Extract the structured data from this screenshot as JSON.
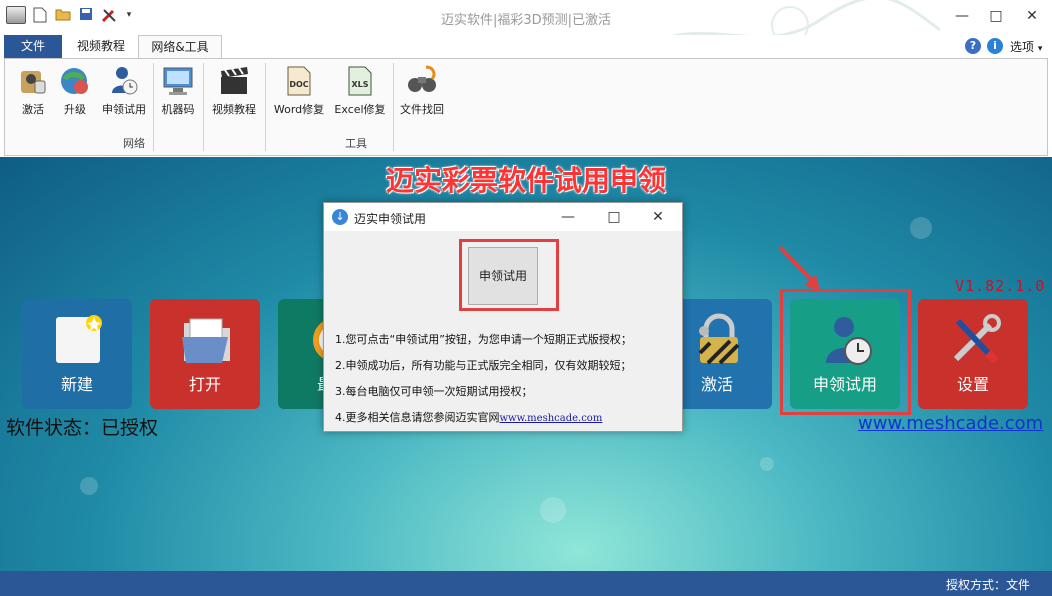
{
  "window": {
    "title": "迈实软件|福彩3D预测|已激活",
    "minimize": "—",
    "maximize": "□",
    "close": "✕"
  },
  "quick_access": [
    "new-doc-icon",
    "open-folder-icon",
    "save-icon",
    "tools-icon",
    "dropdown-icon"
  ],
  "ribbon_tabs": [
    {
      "label": "文件"
    },
    {
      "label": "视频教程"
    },
    {
      "label": "网络&工具",
      "active": true
    }
  ],
  "options_label": "选项",
  "ribbon": {
    "group1": {
      "label": "网络",
      "buttons": [
        {
          "label": "激活",
          "icon": "activate-icon"
        },
        {
          "label": "升级",
          "icon": "upgrade-icon"
        },
        {
          "label": "申领试用",
          "icon": "trial-user-icon"
        },
        {
          "label": "机器码",
          "icon": "machine-code-icon"
        },
        {
          "label": "视频教程",
          "icon": "video-clapper-icon"
        }
      ]
    },
    "group2": {
      "label": "工具",
      "buttons": [
        {
          "label": "Word修复",
          "icon": "doc-file-icon"
        },
        {
          "label": "Excel修复",
          "icon": "xls-file-icon"
        },
        {
          "label": "文件找回",
          "icon": "binoculars-icon"
        }
      ]
    }
  },
  "banner": {
    "title": "迈实彩票软件试用申领"
  },
  "tiles": [
    {
      "label": "新建",
      "color": "#1f6fa6"
    },
    {
      "label": "打开",
      "color": "#c9312c"
    },
    {
      "label": "最近",
      "color": "#0f7a63"
    },
    {
      "label": "激活",
      "color": "#2172ad"
    },
    {
      "label": "申领试用",
      "color": "#179e86"
    },
    {
      "label": "设置",
      "color": "#c9312c"
    }
  ],
  "version": "V1.82.1.0",
  "status": {
    "label": "软件状态：已授权"
  },
  "website": "www.meshcade.com",
  "dialog": {
    "title": "迈实申领试用",
    "button": "申领试用",
    "lines": [
      "1.您可点击“申领试用”按钮，为您申请一个短期正式版授权；",
      "2.申领成功后，所有功能与正式版完全相同，仅有效期较短；",
      "3.每台电脑仅可申领一次短期试用授权；",
      "4.更多相关信息请您参阅迈实官网"
    ],
    "link": "www.meshcade.com"
  },
  "statusbar": {
    "text": "授权方式：文件"
  },
  "colors": {
    "accent": "#2b5797",
    "highlight": "#e24040",
    "version": "#c0162b"
  }
}
